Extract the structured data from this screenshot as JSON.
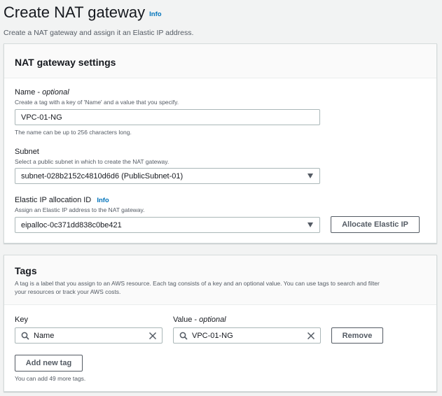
{
  "header": {
    "title": "Create NAT gateway",
    "info_label": "Info",
    "description": "Create a NAT gateway and assign it an Elastic IP address."
  },
  "settings": {
    "title": "NAT gateway settings",
    "name": {
      "label": "Name - ",
      "label_optional": "optional",
      "hint": "Create a tag with a key of 'Name' and a value that you specify.",
      "value": "VPC-01-NG",
      "constraint": "The name can be up to 256 characters long."
    },
    "subnet": {
      "label": "Subnet",
      "hint": "Select a public subnet in which to create the NAT gateway.",
      "selected": "subnet-028b2152c4810d6d6 (PublicSubnet-01)"
    },
    "eip": {
      "label": "Elastic IP allocation ID",
      "info_label": "Info",
      "hint": "Assign an Elastic IP address to the NAT gateway.",
      "selected": "eipalloc-0c371dd838c0be421",
      "allocate_button": "Allocate Elastic IP"
    }
  },
  "tags": {
    "title": "Tags",
    "description_line1": "A tag is a label that you assign to an AWS resource. Each tag consists of a key and an optional value. You can use tags to search and filter",
    "description_line2": "your resources or track your AWS costs.",
    "key_label": "Key",
    "value_label": "Value - ",
    "value_label_optional": "optional",
    "rows": [
      {
        "key": "Name",
        "value": "VPC-01-NG",
        "remove_label": "Remove"
      }
    ],
    "add_button": "Add new tag",
    "remaining": "You can add 49 more tags."
  },
  "colors": {
    "link": "#0073bb",
    "button_text": "#545b64",
    "page_bg": "#f2f3f3"
  }
}
